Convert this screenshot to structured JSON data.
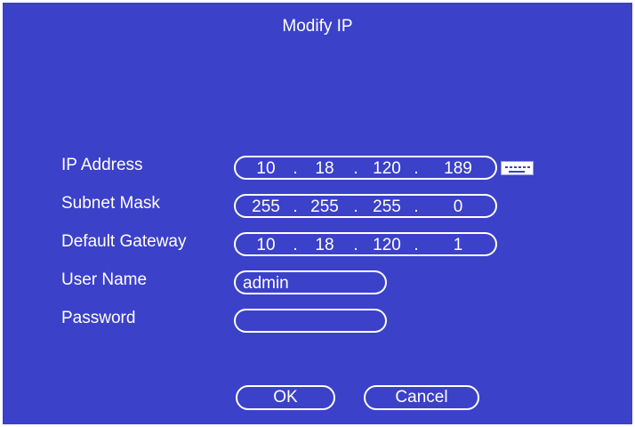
{
  "dialog": {
    "title": "Modify IP"
  },
  "fields": {
    "ip_address": {
      "label": "IP Address",
      "octets": [
        "10",
        "18",
        "120",
        "189"
      ]
    },
    "subnet_mask": {
      "label": "Subnet Mask",
      "octets": [
        "255",
        "255",
        "255",
        "0"
      ]
    },
    "default_gateway": {
      "label": "Default Gateway",
      "octets": [
        "10",
        "18",
        "120",
        "1"
      ]
    },
    "user_name": {
      "label": "User Name",
      "value": "admin"
    },
    "password": {
      "label": "Password",
      "value": ""
    }
  },
  "separator": ".",
  "icons": {
    "keyboard": "keyboard-icon"
  },
  "buttons": {
    "ok": "OK",
    "cancel": "Cancel"
  },
  "colors": {
    "background": "#3b41c9",
    "foreground": "#ffffff"
  }
}
